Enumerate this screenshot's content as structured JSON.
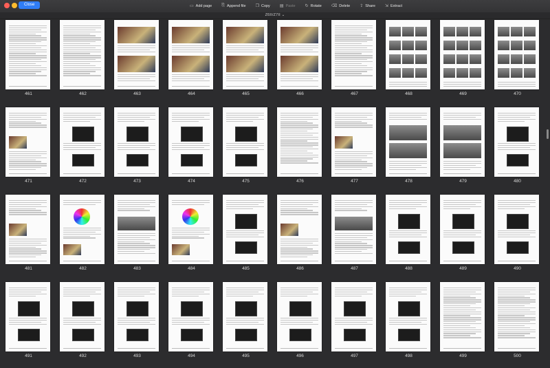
{
  "window": {
    "close_label": "Close",
    "doc_title": "Z6II/Z7II ⌄"
  },
  "toolbar": [
    {
      "name": "add-page-button",
      "icon": "add-page-icon",
      "label": "Add page",
      "enabled": true
    },
    {
      "name": "append-file-button",
      "icon": "append-file-icon",
      "label": "Append file",
      "enabled": true
    },
    {
      "name": "copy-button",
      "icon": "copy-icon",
      "label": "Copy",
      "enabled": true
    },
    {
      "name": "paste-button",
      "icon": "paste-icon",
      "label": "Paste",
      "enabled": false
    },
    {
      "name": "rotate-button",
      "icon": "rotate-icon",
      "label": "Rotate",
      "enabled": true
    },
    {
      "name": "delete-button",
      "icon": "delete-icon",
      "label": "Delete",
      "enabled": true
    },
    {
      "name": "share-button",
      "icon": "share-icon",
      "label": "Share",
      "enabled": true
    },
    {
      "name": "extract-button",
      "icon": "extract-icon",
      "label": "Extract",
      "enabled": true
    }
  ],
  "pages": [
    {
      "num": "461",
      "kind": "text"
    },
    {
      "num": "462",
      "kind": "text"
    },
    {
      "num": "463",
      "kind": "photo2"
    },
    {
      "num": "464",
      "kind": "photo2"
    },
    {
      "num": "465",
      "kind": "photo2"
    },
    {
      "num": "466",
      "kind": "photo2"
    },
    {
      "num": "467",
      "kind": "text"
    },
    {
      "num": "468",
      "kind": "thumbs"
    },
    {
      "num": "469",
      "kind": "thumbs"
    },
    {
      "num": "470",
      "kind": "thumbs"
    },
    {
      "num": "471",
      "kind": "textphoto"
    },
    {
      "num": "472",
      "kind": "menus"
    },
    {
      "num": "473",
      "kind": "menus"
    },
    {
      "num": "474",
      "kind": "menus"
    },
    {
      "num": "475",
      "kind": "menus"
    },
    {
      "num": "476",
      "kind": "text"
    },
    {
      "num": "477",
      "kind": "textphoto"
    },
    {
      "num": "478",
      "kind": "chart"
    },
    {
      "num": "479",
      "kind": "chart"
    },
    {
      "num": "480",
      "kind": "menus"
    },
    {
      "num": "481",
      "kind": "textphoto"
    },
    {
      "num": "482",
      "kind": "wheel"
    },
    {
      "num": "483",
      "kind": "table"
    },
    {
      "num": "484",
      "kind": "wheel"
    },
    {
      "num": "485",
      "kind": "menus"
    },
    {
      "num": "486",
      "kind": "textphoto"
    },
    {
      "num": "487",
      "kind": "table"
    },
    {
      "num": "488",
      "kind": "menus"
    },
    {
      "num": "489",
      "kind": "menus"
    },
    {
      "num": "490",
      "kind": "menus"
    },
    {
      "num": "491",
      "kind": "menus"
    },
    {
      "num": "492",
      "kind": "menus"
    },
    {
      "num": "493",
      "kind": "menus"
    },
    {
      "num": "494",
      "kind": "menus"
    },
    {
      "num": "495",
      "kind": "menus"
    },
    {
      "num": "496",
      "kind": "menus"
    },
    {
      "num": "497",
      "kind": "menus"
    },
    {
      "num": "498",
      "kind": "menus"
    },
    {
      "num": "499",
      "kind": "text"
    },
    {
      "num": "500",
      "kind": "text"
    }
  ]
}
